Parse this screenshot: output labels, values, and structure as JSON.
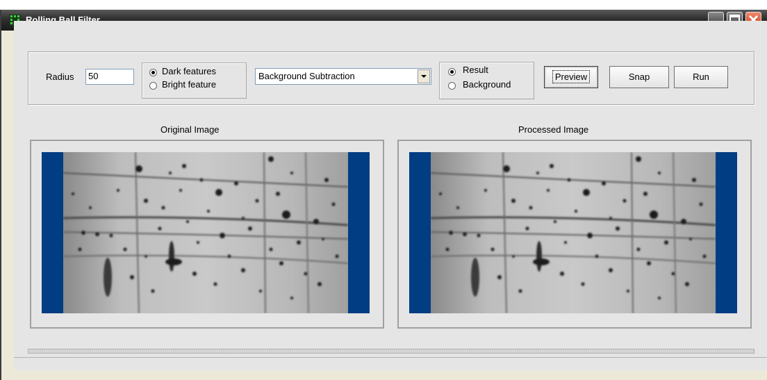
{
  "window": {
    "title": "Rolling Ball Filter",
    "app_icon": "grid-icon",
    "controls": [
      "minimize-icon",
      "maximize-icon",
      "close-icon"
    ]
  },
  "toolbar": {
    "radius_label": "Radius",
    "radius_value": "50",
    "feature_options": [
      {
        "label": "Dark features",
        "selected": true
      },
      {
        "label": "Bright feature",
        "selected": false
      }
    ],
    "mode_select": {
      "selected": "Background Subtraction"
    },
    "output_options": [
      {
        "label": "Result",
        "selected": true
      },
      {
        "label": "Background",
        "selected": false
      }
    ],
    "preview_label": "Preview",
    "snap_label": "Snap",
    "run_label": "Run"
  },
  "images": {
    "original_caption": "Original Image",
    "processed_caption": "Processed Image"
  },
  "colors": {
    "image_border_blue": "#003d82",
    "title_bar": "#2e2e2e",
    "close_button": "#d4482a"
  }
}
